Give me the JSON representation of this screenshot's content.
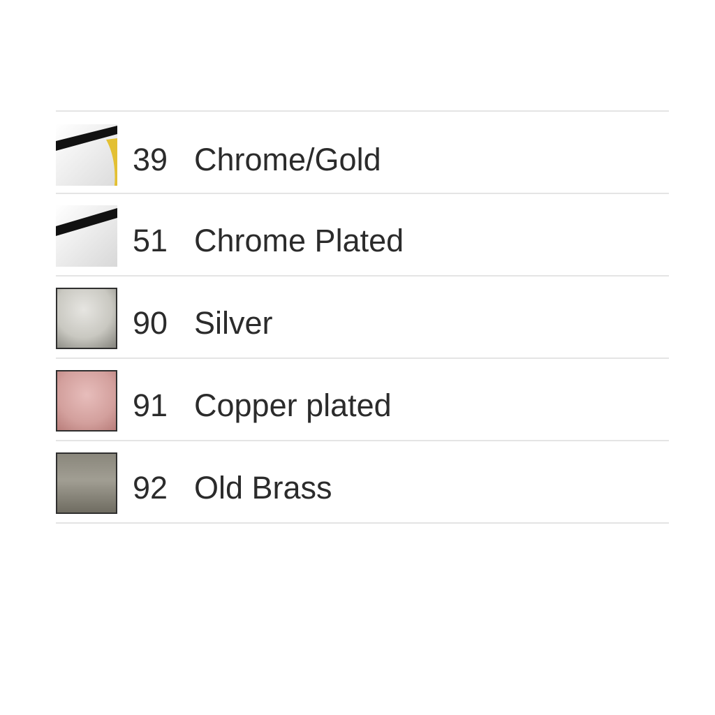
{
  "finishes": [
    {
      "code": "39",
      "name": "Chrome/Gold",
      "swatch_colors": {
        "base": "#f2f2f2",
        "accent": "#e3c033",
        "stroke": "#111111"
      }
    },
    {
      "code": "51",
      "name": "Chrome Plated",
      "swatch_colors": {
        "base": "#f1f1f1",
        "stroke": "#111111"
      }
    },
    {
      "code": "90",
      "name": "Silver",
      "swatch_colors": {
        "light": "#d8d7d2",
        "dark": "#8d8c85",
        "border": "#2f2f2f"
      }
    },
    {
      "code": "91",
      "name": "Copper plated",
      "swatch_colors": {
        "light": "#dba9a7",
        "dark": "#b77b78",
        "border": "#3a2a2a"
      }
    },
    {
      "code": "92",
      "name": "Old Brass",
      "swatch_colors": {
        "light": "#9a978c",
        "dark": "#6f6c61",
        "border": "#2a2a2a"
      }
    }
  ]
}
